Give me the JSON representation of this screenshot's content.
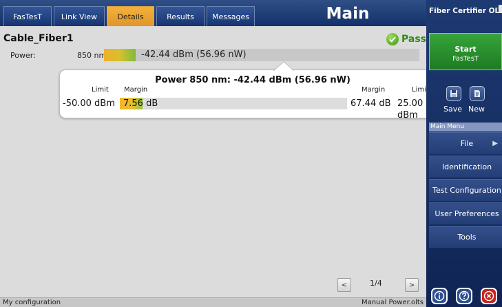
{
  "tabs": [
    {
      "label": "FasTesT",
      "active": false
    },
    {
      "label": "Link View",
      "active": false
    },
    {
      "label": "Details",
      "active": true
    },
    {
      "label": "Results",
      "active": false
    },
    {
      "label": "Messages",
      "active": false
    }
  ],
  "header": {
    "title": "Main"
  },
  "cable": {
    "name": "Cable_Fiber1",
    "status": "Pass"
  },
  "power": {
    "label": "Power:",
    "wavelength": "850 nm",
    "value_text": "-42.44 dBm (56.96 nW)"
  },
  "popup": {
    "title": "Power 850 nm: -42.44 dBm (56.96 nW)",
    "left_limit_label": "Limit",
    "left_margin_label": "Margin",
    "right_margin_label": "Margin",
    "right_limit_label": "Limit",
    "left_limit_value": "-50.00 dBm",
    "left_margin_value": "7.56 dB",
    "right_margin_value": "67.44 dB",
    "right_limit_value": "25.00 dBm"
  },
  "pager": {
    "prev": "<",
    "next": ">",
    "indicator": "1/4"
  },
  "statusbar": {
    "left": "My configuration",
    "right": "Manual Power.olts"
  },
  "right_panel": {
    "title": "Fiber Certifier OLTS",
    "start_label": "Start",
    "start_sub": "FasTesT",
    "save_label": "Save",
    "new_label": "New",
    "menu_header": "Main Menu",
    "menu_items": [
      {
        "label": "File",
        "has_arrow": true
      },
      {
        "label": "Identification",
        "has_arrow": false
      },
      {
        "label": "Test Configuration",
        "has_arrow": false
      },
      {
        "label": "User Preferences",
        "has_arrow": false
      },
      {
        "label": "Tools",
        "has_arrow": false
      }
    ],
    "menu_arrow": "▶"
  },
  "colors": {
    "accent_orange": "#f2b23c",
    "pass_green": "#2e8a10",
    "start_green": "#2a9430",
    "panel_blue": "#1e3a72",
    "close_red": "#c5231d"
  },
  "icons": [
    "pass-check-icon",
    "save-icon",
    "new-document-icon",
    "info-icon",
    "help-icon",
    "close-icon"
  ]
}
